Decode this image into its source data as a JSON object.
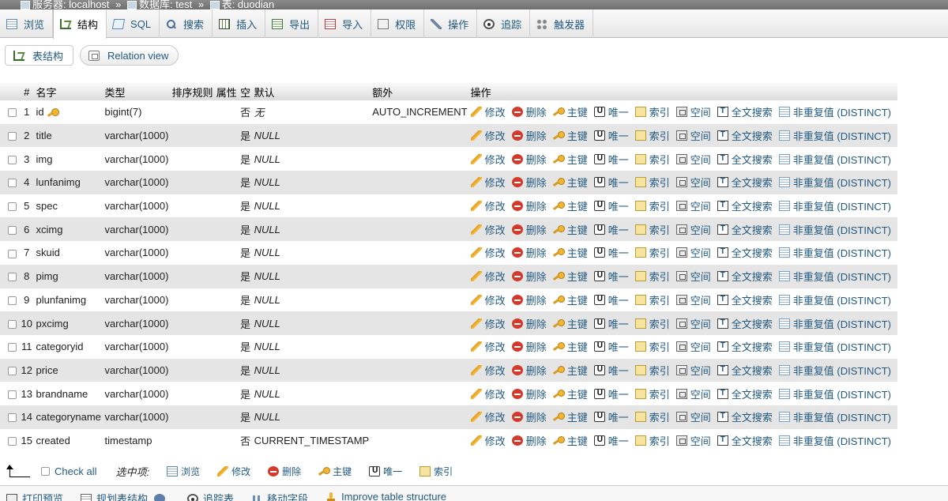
{
  "breadcrumb": {
    "server": "服务器: localhost",
    "database": "数据库: test",
    "table": "表: duodian",
    "separator": "»"
  },
  "tabs": [
    {
      "label": "浏览",
      "icon": "browse-icon",
      "active": false
    },
    {
      "label": "结构",
      "icon": "structure-icon",
      "active": true
    },
    {
      "label": "SQL",
      "icon": "sql-icon",
      "active": false
    },
    {
      "label": "搜索",
      "icon": "search-icon",
      "active": false
    },
    {
      "label": "插入",
      "icon": "insert-icon",
      "active": false
    },
    {
      "label": "导出",
      "icon": "export-icon",
      "active": false
    },
    {
      "label": "导入",
      "icon": "import-icon",
      "active": false
    },
    {
      "label": "权限",
      "icon": "privileges-icon",
      "active": false
    },
    {
      "label": "操作",
      "icon": "operations-icon",
      "active": false
    },
    {
      "label": "追踪",
      "icon": "tracking-icon",
      "active": false
    },
    {
      "label": "触发器",
      "icon": "triggers-icon",
      "active": false
    }
  ],
  "subnav": {
    "table_structure": "表结构",
    "relation_view": "Relation view"
  },
  "columns": [
    "#",
    "名字",
    "类型",
    "排序规则",
    "属性",
    "空",
    "默认",
    "额外",
    "操作"
  ],
  "actions": {
    "change": "修改",
    "drop": "删除",
    "primary": "主键",
    "unique": "唯一",
    "index": "索引",
    "spatial": "空间",
    "fulltext": "全文搜索",
    "distinct": "非重复值 (DISTINCT)"
  },
  "rows": [
    {
      "num": "1",
      "name": "id",
      "type": "bigint(7)",
      "collation": "",
      "attributes": "",
      "null": "否",
      "default": "无",
      "extra": "AUTO_INCREMENT",
      "primary_key": true
    },
    {
      "num": "2",
      "name": "title",
      "type": "varchar(1000)",
      "collation": "",
      "attributes": "",
      "null": "是",
      "default": "NULL",
      "extra": ""
    },
    {
      "num": "3",
      "name": "img",
      "type": "varchar(1000)",
      "collation": "",
      "attributes": "",
      "null": "是",
      "default": "NULL",
      "extra": ""
    },
    {
      "num": "4",
      "name": "lunfanimg",
      "type": "varchar(1000)",
      "collation": "",
      "attributes": "",
      "null": "是",
      "default": "NULL",
      "extra": ""
    },
    {
      "num": "5",
      "name": "spec",
      "type": "varchar(1000)",
      "collation": "",
      "attributes": "",
      "null": "是",
      "default": "NULL",
      "extra": ""
    },
    {
      "num": "6",
      "name": "xcimg",
      "type": "varchar(1000)",
      "collation": "",
      "attributes": "",
      "null": "是",
      "default": "NULL",
      "extra": ""
    },
    {
      "num": "7",
      "name": "skuid",
      "type": "varchar(1000)",
      "collation": "",
      "attributes": "",
      "null": "是",
      "default": "NULL",
      "extra": ""
    },
    {
      "num": "8",
      "name": "pimg",
      "type": "varchar(1000)",
      "collation": "",
      "attributes": "",
      "null": "是",
      "default": "NULL",
      "extra": ""
    },
    {
      "num": "9",
      "name": "plunfanimg",
      "type": "varchar(1000)",
      "collation": "",
      "attributes": "",
      "null": "是",
      "default": "NULL",
      "extra": ""
    },
    {
      "num": "10",
      "name": "pxcimg",
      "type": "varchar(1000)",
      "collation": "",
      "attributes": "",
      "null": "是",
      "default": "NULL",
      "extra": ""
    },
    {
      "num": "11",
      "name": "categoryid",
      "type": "varchar(1000)",
      "collation": "",
      "attributes": "",
      "null": "是",
      "default": "NULL",
      "extra": ""
    },
    {
      "num": "12",
      "name": "price",
      "type": "varchar(1000)",
      "collation": "",
      "attributes": "",
      "null": "是",
      "default": "NULL",
      "extra": ""
    },
    {
      "num": "13",
      "name": "brandname",
      "type": "varchar(1000)",
      "collation": "",
      "attributes": "",
      "null": "是",
      "default": "NULL",
      "extra": ""
    },
    {
      "num": "14",
      "name": "categoryname",
      "type": "varchar(1000)",
      "collation": "",
      "attributes": "",
      "null": "是",
      "default": "NULL",
      "extra": ""
    },
    {
      "num": "15",
      "name": "created",
      "type": "timestamp",
      "collation": "",
      "attributes": "",
      "null": "否",
      "default": "CURRENT_TIMESTAMP",
      "extra": ""
    }
  ],
  "bulk": {
    "check_all": "Check all",
    "with_selected": "选中项:",
    "browse": "浏览",
    "change": "修改",
    "drop": "删除",
    "primary": "主键",
    "unique": "唯一",
    "index": "索引"
  },
  "bottom": {
    "print_view": "打印预览",
    "propose_structure": "规划表结构",
    "track_table": "追踪表",
    "move_columns": "移动字段",
    "improve_structure": "Improve table structure"
  }
}
